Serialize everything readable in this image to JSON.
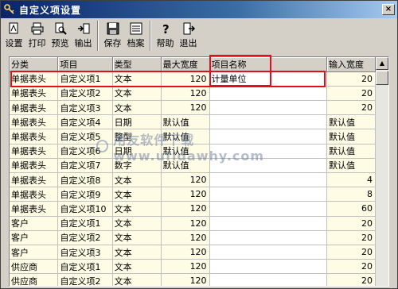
{
  "window": {
    "title": "自定义项设置",
    "close_label": "×"
  },
  "toolbar": {
    "groups": [
      [
        {
          "label": "设置",
          "icon": "setup-icon"
        },
        {
          "label": "打印",
          "icon": "print-icon"
        },
        {
          "label": "预览",
          "icon": "preview-icon"
        },
        {
          "label": "输出",
          "icon": "export-icon"
        }
      ],
      [
        {
          "label": "保存",
          "icon": "save-icon"
        },
        {
          "label": "档案",
          "icon": "archive-icon"
        }
      ],
      [
        {
          "label": "帮助",
          "icon": "help-icon"
        },
        {
          "label": "退出",
          "icon": "exit-icon"
        }
      ]
    ]
  },
  "grid": {
    "columns": [
      "分类",
      "项目",
      "类型",
      "最大宽度",
      "项目名称",
      "输入宽度"
    ],
    "rows": [
      [
        "单据表头",
        "自定义项1",
        "文本",
        "120",
        "计量单位",
        "20"
      ],
      [
        "单据表头",
        "自定义项2",
        "文本",
        "120",
        "",
        "20"
      ],
      [
        "单据表头",
        "自定义项3",
        "文本",
        "120",
        "",
        "20"
      ],
      [
        "单据表头",
        "自定义项4",
        "日期",
        "默认值",
        "",
        "默认值"
      ],
      [
        "单据表头",
        "自定义项5",
        "整型",
        "默认值",
        "",
        "默认值"
      ],
      [
        "单据表头",
        "自定义项6",
        "日期",
        "默认值",
        "",
        "默认值"
      ],
      [
        "单据表头",
        "自定义项7",
        "数字",
        "默认值",
        "",
        "默认值"
      ],
      [
        "单据表头",
        "自定义项8",
        "文本",
        "120",
        "",
        "4"
      ],
      [
        "单据表头",
        "自定义项9",
        "文本",
        "120",
        "",
        "8"
      ],
      [
        "单据表头",
        "自定义项10",
        "文本",
        "120",
        "",
        "60"
      ],
      [
        "客户",
        "自定义项1",
        "文本",
        "120",
        "",
        "20"
      ],
      [
        "客户",
        "自定义项2",
        "文本",
        "120",
        "",
        "20"
      ],
      [
        "客户",
        "自定义项3",
        "文本",
        "120",
        "",
        "20"
      ],
      [
        "供应商",
        "自定义项1",
        "文本",
        "120",
        "",
        "20"
      ],
      [
        "供应商",
        "自定义项2",
        "文本",
        "120",
        "",
        "20"
      ]
    ]
  },
  "watermark": {
    "text": "用友软件下载 www.ufidawhy.com"
  },
  "colors": {
    "highlight": "#e0101b",
    "readonly_cell": "#fffce6",
    "title_bar": "#0a246a"
  }
}
